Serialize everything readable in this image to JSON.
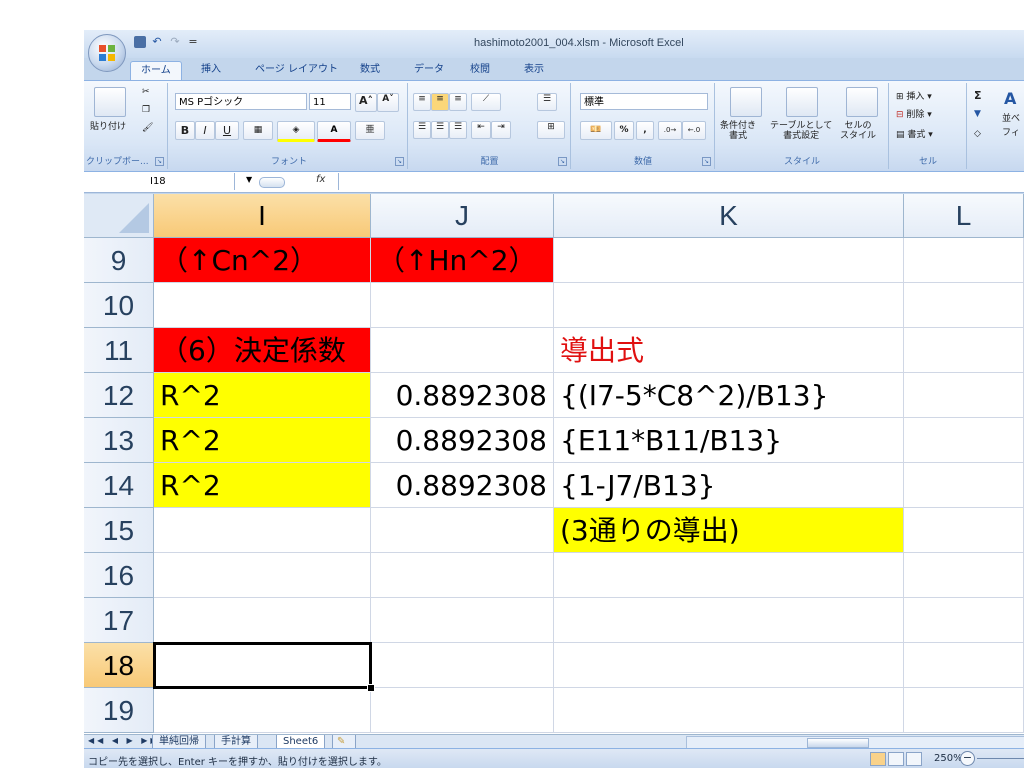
{
  "app": {
    "title": "hashimoto2001_004.xlsm - Microsoft Excel"
  },
  "qat": {
    "save_icon": "save-icon",
    "undo_label": "↶",
    "redo_label": "↷",
    "customize_label": "="
  },
  "tabs": [
    "ホーム",
    "挿入",
    "ページ レイアウト",
    "数式",
    "データ",
    "校閲",
    "表示"
  ],
  "ribbon": {
    "clipboard": {
      "label": "クリップボー...",
      "paste": "貼り付け"
    },
    "font": {
      "label": "フォント",
      "font_name": "MS Pゴシック",
      "font_size": "11",
      "bold": "B",
      "italic": "I",
      "underline": "U"
    },
    "alignment": {
      "label": "配置"
    },
    "number": {
      "label": "数値",
      "format": "標準",
      "percent": "%",
      "comma": ","
    },
    "styles": {
      "label": "スタイル",
      "cond_format": "条件付き\n書式",
      "table_format": "テーブルとして\n書式設定",
      "cell_style": "セルの\nスタイル"
    },
    "cells": {
      "label": "セル",
      "insert": "挿入",
      "delete": "削除",
      "format": "書式"
    },
    "editing": {
      "sum": "Σ",
      "sort": "並べ",
      "filter": "フィ"
    }
  },
  "formula_bar": {
    "name_box": "I18",
    "fx": "fx",
    "formula": ""
  },
  "columns": [
    {
      "key": "I",
      "label": "I",
      "selected": true
    },
    {
      "key": "J",
      "label": "J",
      "selected": false
    },
    {
      "key": "K",
      "label": "K",
      "selected": false
    },
    {
      "key": "L",
      "label": "L",
      "selected": false
    }
  ],
  "rows": [
    {
      "num": "9",
      "cells": {
        "I": "（↑Cn^2）",
        "J": "（↑Hn^2）",
        "K": "",
        "L": ""
      }
    },
    {
      "num": "10",
      "cells": {
        "I": "",
        "J": "",
        "K": "",
        "L": ""
      }
    },
    {
      "num": "11",
      "cells": {
        "I": "（6）決定係数",
        "J": "",
        "K": "導出式",
        "L": ""
      }
    },
    {
      "num": "12",
      "cells": {
        "I": "R^2",
        "J": "0.8892308",
        "K": "{(I7-5*C8^2)/B13}",
        "L": ""
      }
    },
    {
      "num": "13",
      "cells": {
        "I": "R^2",
        "J": "0.8892308",
        "K": "{E11*B11/B13}",
        "L": ""
      }
    },
    {
      "num": "14",
      "cells": {
        "I": "R^2",
        "J": "0.8892308",
        "K": "{1-J7/B13}",
        "L": ""
      }
    },
    {
      "num": "15",
      "cells": {
        "I": "",
        "J": "",
        "K": "(3通りの導出)",
        "L": ""
      }
    },
    {
      "num": "16",
      "cells": {
        "I": "",
        "J": "",
        "K": "",
        "L": ""
      }
    },
    {
      "num": "17",
      "cells": {
        "I": "",
        "J": "",
        "K": "",
        "L": ""
      }
    },
    {
      "num": "18",
      "cells": {
        "I": "",
        "J": "",
        "K": "",
        "L": ""
      }
    },
    {
      "num": "19",
      "cells": {
        "I": "",
        "J": "",
        "K": "",
        "L": ""
      }
    }
  ],
  "selected_row": "18",
  "fills": {
    "red": "#ff0000",
    "yellow": "#ffff00",
    "red_text": "#e01010"
  },
  "sheet_tabs": [
    {
      "label": "単純回帰",
      "active": false
    },
    {
      "label": "手計算",
      "active": false
    },
    {
      "label": "Sheet6",
      "active": true
    }
  ],
  "status": {
    "message": "コピー先を選択し、Enter キーを押すか、貼り付けを選択します。",
    "zoom": "250%",
    "zoom_minus": "−"
  }
}
